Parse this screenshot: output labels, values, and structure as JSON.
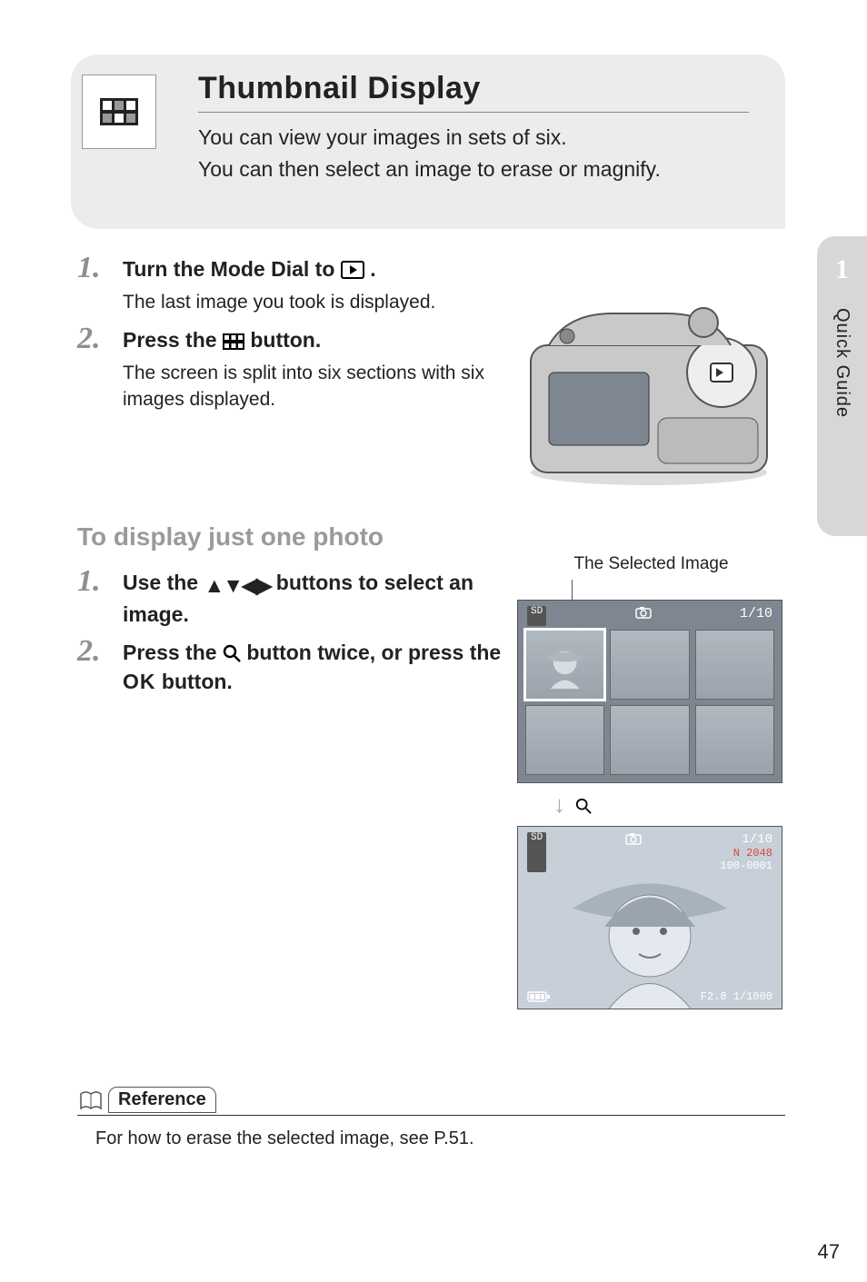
{
  "side": {
    "chapter_num": "1",
    "chapter_label": "Quick Guide"
  },
  "hero": {
    "title": "Thumbnail Display",
    "line1": "You can view your images in sets of six.",
    "line2": "You can then select an image to erase or magnify."
  },
  "stepsA": [
    {
      "num": "1.",
      "title_before": "Turn the Mode Dial to ",
      "title_after": " .",
      "desc": "The last image you took is displayed."
    },
    {
      "num": "2.",
      "title_before": "Press the ",
      "title_after": " button.",
      "desc": "The screen is split into six sections with six images displayed."
    }
  ],
  "subheading": "To display just one photo",
  "stepsB": [
    {
      "num": "1.",
      "title_before": "Use the ",
      "title_after": " buttons to select an image."
    },
    {
      "num": "2.",
      "title_before": " Press the ",
      "title_mid": " button twice, or press the ",
      "title_ok": "O",
      "title_ok2": " button."
    }
  ],
  "selected_label": "The Selected Image",
  "thumb_overlay": {
    "left_badge": "SD",
    "counter": "1/10"
  },
  "single_overlay": {
    "left_badge": "SD",
    "counter": "1/10",
    "size_badge": "N 2048",
    "file_no": "100-0001",
    "bottom": "F2.8 1/1000"
  },
  "reference": {
    "label": "Reference",
    "text": "For how to erase the selected image, see P.51."
  },
  "page_number": "47"
}
